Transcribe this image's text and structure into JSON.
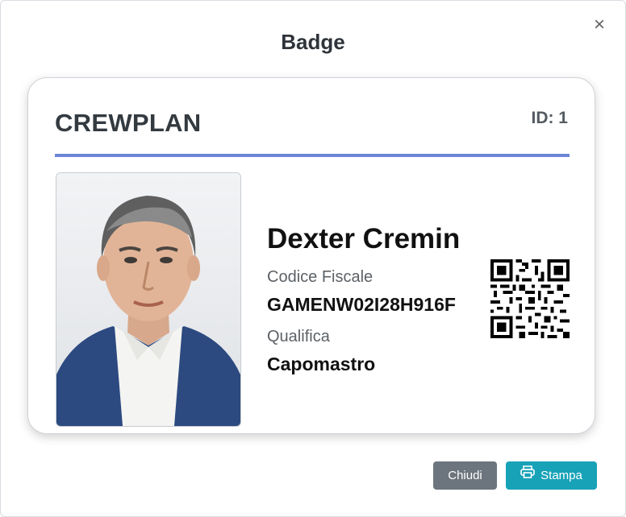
{
  "modal": {
    "title": "Badge",
    "close_icon": "close-icon"
  },
  "badge": {
    "brand": "CREWPLAN",
    "id_label": "ID: 1",
    "name": "Dexter Cremin",
    "fields": [
      {
        "label": "Codice Fiscale",
        "value": "GAMENW02I28H916F"
      },
      {
        "label": "Qualifica",
        "value": "Capomastro"
      }
    ],
    "photo_icon": "person-photo",
    "qr_icon": "qr-code-icon",
    "accent_color": "#6b86d6"
  },
  "footer": {
    "close_label": "Chiudi",
    "print_label": "Stampa",
    "print_icon": "printer-icon",
    "close_color": "#6c757d",
    "print_color": "#17a2b8"
  }
}
